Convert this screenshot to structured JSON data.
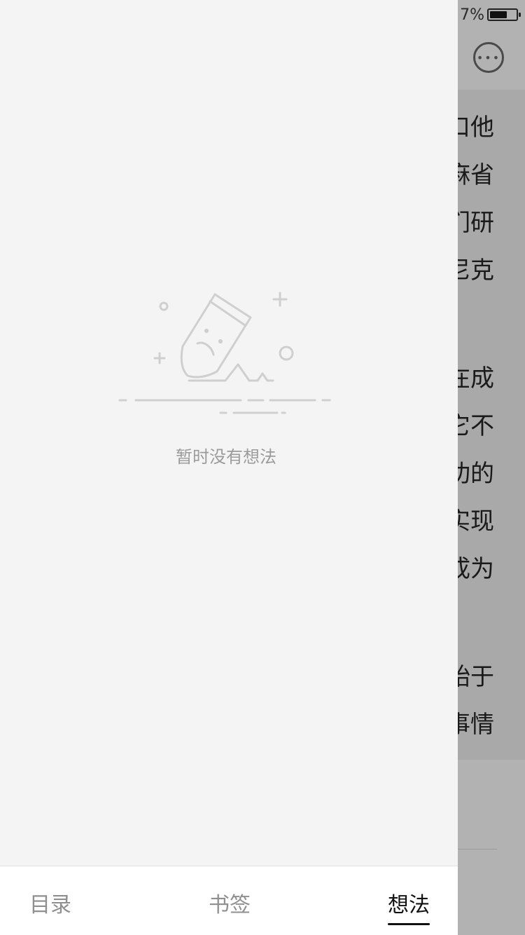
{
  "background_page": {
    "status_bar": {
      "battery_text": "7%",
      "battery_level": 0.67
    },
    "more_icon": "more-horizontal-circle-icon",
    "text_fragments": [
      "口他",
      "麻省",
      "们研",
      "尼克",
      "在成",
      "它不",
      "功的",
      "实现",
      "成为",
      "始于",
      "事情"
    ]
  },
  "drawer": {
    "empty_state": {
      "illustration_icon": "sad-pen-icon",
      "message": "暂时没有想法"
    },
    "tabs": [
      {
        "label": "目录",
        "active": false
      },
      {
        "label": "书签",
        "active": false
      },
      {
        "label": "想法",
        "active": true
      }
    ]
  },
  "colors": {
    "drawer_bg": "#f4f4f4",
    "tab_inactive": "#8f8f8f",
    "tab_active": "#111111",
    "overlay": "#b2b2b2"
  }
}
